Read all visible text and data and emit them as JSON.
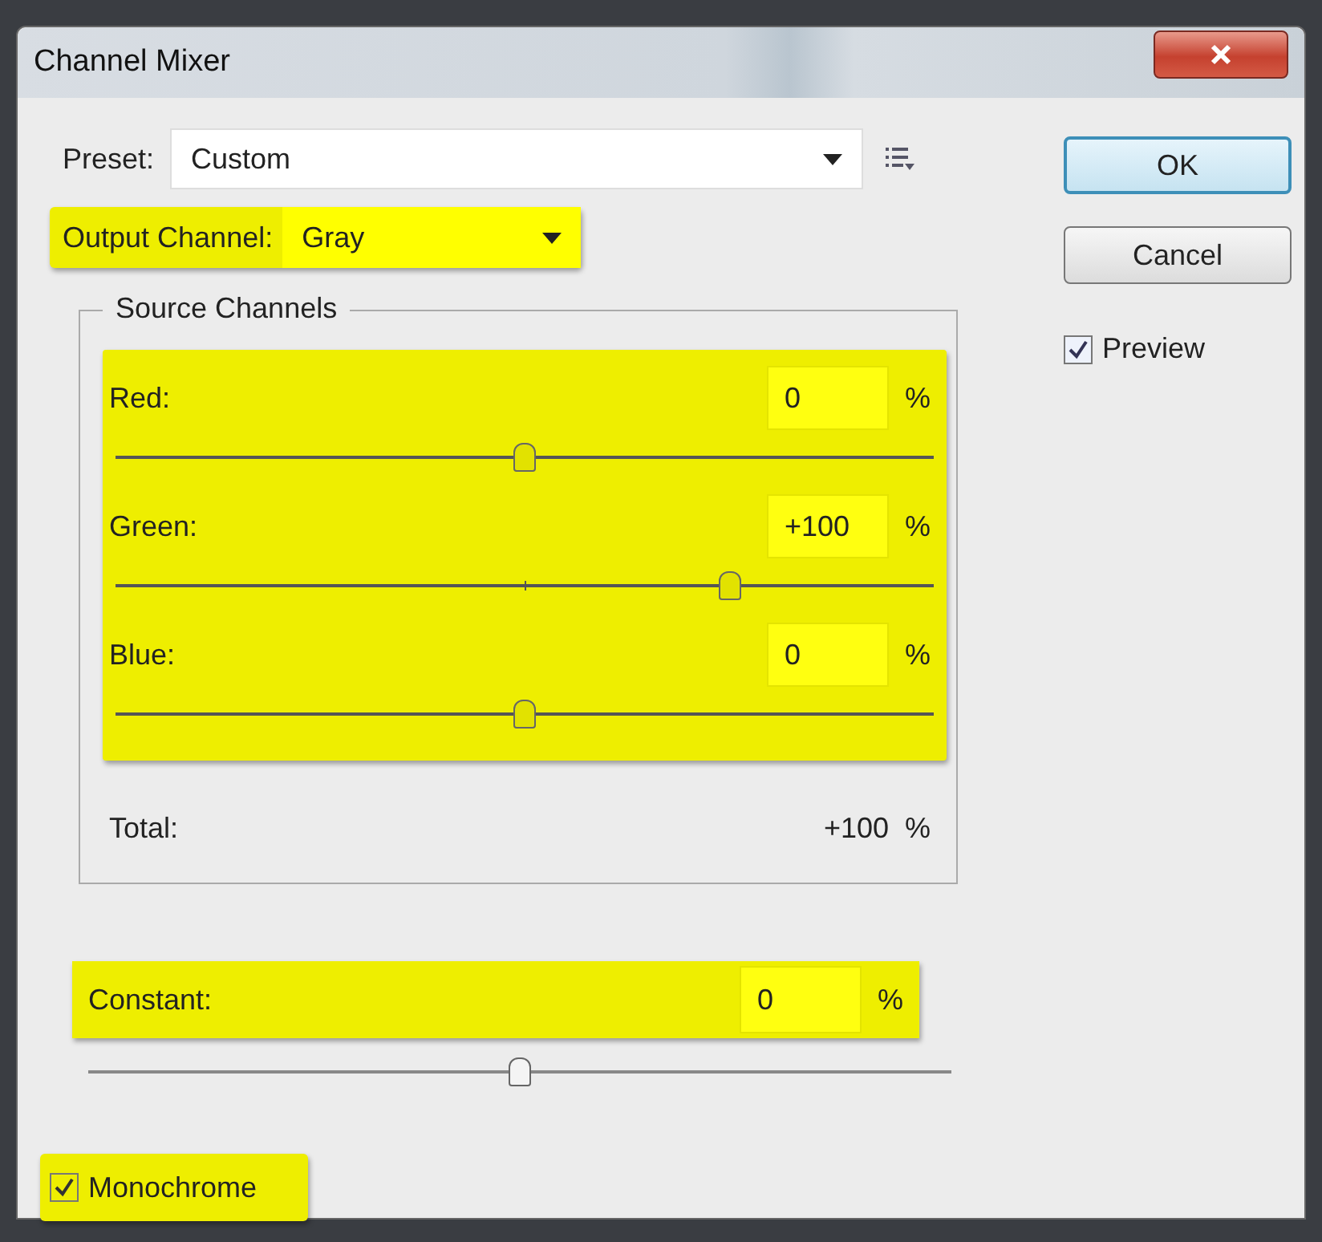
{
  "window": {
    "title": "Channel Mixer"
  },
  "preset": {
    "label": "Preset:",
    "value": "Custom"
  },
  "output_channel": {
    "label": "Output Channel:",
    "value": "Gray",
    "highlighted": true
  },
  "source_channels": {
    "title": "Source Channels",
    "highlighted": true,
    "channels": [
      {
        "name": "Red:",
        "value": "0",
        "unit": "%",
        "level": 0.5
      },
      {
        "name": "Green:",
        "value": "+100",
        "unit": "%",
        "level": 0.75
      },
      {
        "name": "Blue:",
        "value": "0",
        "unit": "%",
        "level": 0.5
      }
    ],
    "total": {
      "label": "Total:",
      "value": "+100",
      "unit": "%"
    }
  },
  "constant": {
    "label": "Constant:",
    "value": "0",
    "unit": "%",
    "level": 0.5,
    "highlighted": true
  },
  "monochrome": {
    "label": "Monochrome",
    "checked": true,
    "highlighted": true
  },
  "buttons": [
    {
      "label": "OK",
      "default": true
    },
    {
      "label": "Cancel",
      "default": false
    }
  ],
  "preview": {
    "label": "Preview",
    "checked": true
  }
}
